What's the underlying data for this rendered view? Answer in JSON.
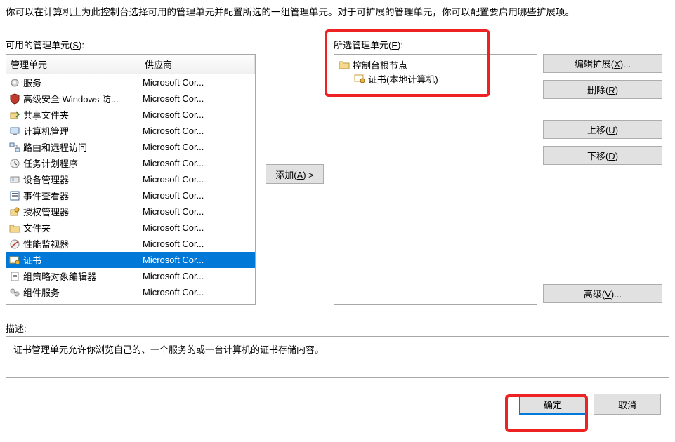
{
  "intro": "你可以在计算机上为此控制台选择可用的管理单元并配置所选的一组管理单元。对于可扩展的管理单元，你可以配置要启用哪些扩展项。",
  "available_label_pre": "可用的管理单元(",
  "available_label_key": "S",
  "available_label_post": "):",
  "selected_label_pre": "所选管理单元(",
  "selected_label_key": "E",
  "selected_label_post": "):",
  "header": {
    "name": "管理单元",
    "vendor": "供应商"
  },
  "rows": [
    {
      "icon": "gear",
      "name": "服务",
      "vendor": "Microsoft Cor..."
    },
    {
      "icon": "shield",
      "name": "高级安全 Windows 防...",
      "vendor": "Microsoft Cor..."
    },
    {
      "icon": "share",
      "name": "共享文件夹",
      "vendor": "Microsoft Cor..."
    },
    {
      "icon": "computer",
      "name": "计算机管理",
      "vendor": "Microsoft Cor..."
    },
    {
      "icon": "route",
      "name": "路由和远程访问",
      "vendor": "Microsoft Cor..."
    },
    {
      "icon": "clock",
      "name": "任务计划程序",
      "vendor": "Microsoft Cor..."
    },
    {
      "icon": "device",
      "name": "设备管理器",
      "vendor": "Microsoft Cor..."
    },
    {
      "icon": "event",
      "name": "事件查看器",
      "vendor": "Microsoft Cor..."
    },
    {
      "icon": "auth",
      "name": "授权管理器",
      "vendor": "Microsoft Cor..."
    },
    {
      "icon": "folder",
      "name": "文件夹",
      "vendor": "Microsoft Cor..."
    },
    {
      "icon": "perf",
      "name": "性能监视器",
      "vendor": "Microsoft Cor..."
    },
    {
      "icon": "cert",
      "name": "证书",
      "vendor": "Microsoft Cor...",
      "selected": true
    },
    {
      "icon": "policy",
      "name": "组策略对象编辑器",
      "vendor": "Microsoft Cor..."
    },
    {
      "icon": "comp",
      "name": "组件服务",
      "vendor": "Microsoft Cor..."
    },
    {
      "icon": "blank",
      "name": "",
      "vendor": ""
    },
    {
      "icon": "blank",
      "name": "",
      "vendor": ""
    },
    {
      "icon": "blank",
      "name": "",
      "vendor": ""
    }
  ],
  "add_btn_pre": "添加(",
  "add_btn_key": "A",
  "add_btn_post": ") >",
  "tree": {
    "root": "控制台根节点",
    "child": "证书(本地计算机)"
  },
  "buttons": {
    "edit_pre": "编辑扩展(",
    "edit_key": "X",
    "edit_post": ")...",
    "remove_pre": "删除(",
    "remove_key": "R",
    "remove_post": ")",
    "up_pre": "上移(",
    "up_key": "U",
    "up_post": ")",
    "down_pre": "下移(",
    "down_key": "D",
    "down_post": ")",
    "adv_pre": "高级(",
    "adv_key": "V",
    "adv_post": ")..."
  },
  "desc_label": "描述:",
  "desc_text": "证书管理单元允许你浏览自己的、一个服务的或一台计算机的证书存储内容。",
  "ok": "确定",
  "cancel": "取消",
  "colors": {
    "highlight": "#e22",
    "select": "#0078d7"
  }
}
